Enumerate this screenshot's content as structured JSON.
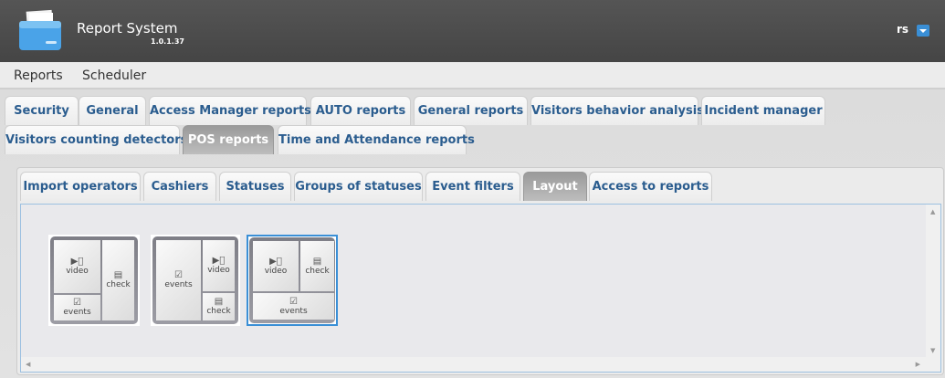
{
  "header": {
    "title": "Report System",
    "version": "1.0.1.37",
    "user": "rs"
  },
  "menu": [
    "Reports",
    "Scheduler"
  ],
  "tabs_row1": [
    "Security",
    "General",
    "Access Manager reports",
    "AUTO reports",
    "General reports",
    "Visitors behavior analysis",
    "Incident manager"
  ],
  "tabs_row2": [
    "Visitors counting detectors",
    "POS reports",
    "Time and Attendance reports"
  ],
  "active_tab": "POS reports",
  "subtabs": [
    "Import operators",
    "Cashiers",
    "Statuses",
    "Groups of statuses",
    "Event filters",
    "Layout",
    "Access to reports"
  ],
  "active_subtab": "Layout",
  "cells": {
    "video": "video",
    "check": "check",
    "events": "events"
  },
  "selected_layout": 3,
  "colors": {
    "accent": "#3a8fd6",
    "tab_text": "#2b5d8f"
  }
}
